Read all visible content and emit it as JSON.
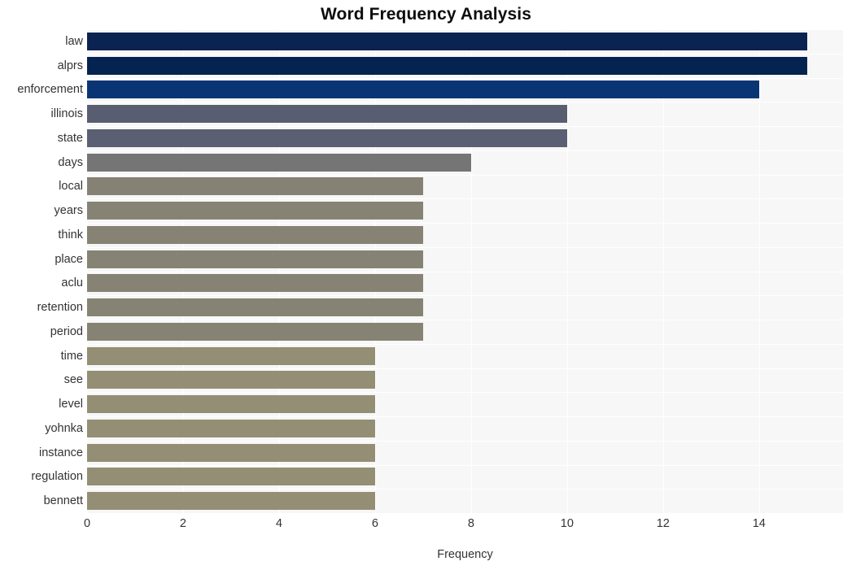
{
  "chart_data": {
    "type": "bar",
    "orientation": "horizontal",
    "title": "Word Frequency Analysis",
    "xlabel": "Frequency",
    "ylabel": "",
    "xlim": [
      0,
      15.75
    ],
    "xticks": [
      0,
      2,
      4,
      6,
      8,
      10,
      12,
      14
    ],
    "xtick_labels": [
      "0",
      "2",
      "4",
      "6",
      "8",
      "10",
      "12",
      "14"
    ],
    "grid": true,
    "legend": "none",
    "categories": [
      "law",
      "alprs",
      "enforcement",
      "illinois",
      "state",
      "days",
      "local",
      "years",
      "think",
      "place",
      "aclu",
      "retention",
      "period",
      "time",
      "see",
      "level",
      "yohnka",
      "instance",
      "regulation",
      "bennett"
    ],
    "values": [
      15,
      15,
      14,
      10,
      10,
      8,
      7,
      7,
      7,
      7,
      7,
      7,
      7,
      6,
      6,
      6,
      6,
      6,
      6,
      6
    ],
    "bar_colors": [
      "#0a2351",
      "#042350",
      "#0a3575",
      "#585d72",
      "#5b5f73",
      "#757575",
      "#858275",
      "#868374",
      "#868374",
      "#868374",
      "#868374",
      "#868374",
      "#868374",
      "#948e75",
      "#948e75",
      "#948e75",
      "#948e75",
      "#948e75",
      "#948e75",
      "#948e75"
    ],
    "plot_background": "#f7f7f7",
    "grid_color": "#ffffff",
    "figure_background": "#ffffff"
  }
}
